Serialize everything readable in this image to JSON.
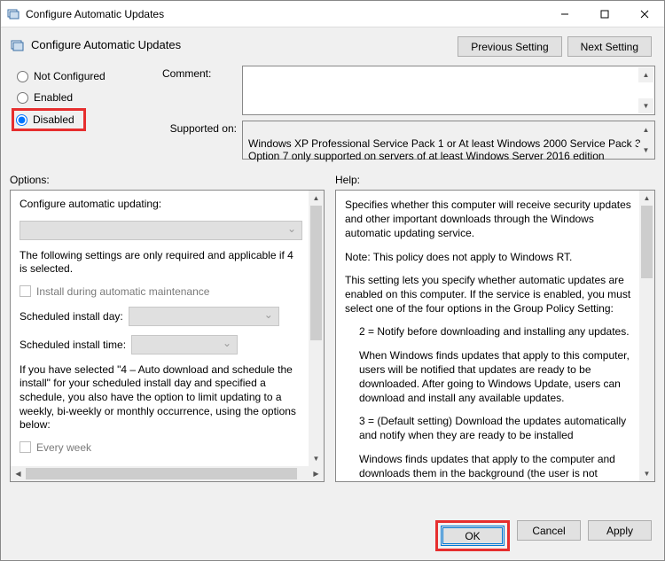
{
  "window": {
    "title": "Configure Automatic Updates"
  },
  "header": {
    "title": "Configure Automatic Updates",
    "prev_btn": "Previous Setting",
    "next_btn": "Next Setting"
  },
  "radios": {
    "not_configured": "Not Configured",
    "enabled": "Enabled",
    "disabled": "Disabled",
    "selected": "disabled"
  },
  "fields": {
    "comment_label": "Comment:",
    "comment_value": "",
    "supported_label": "Supported on:",
    "supported_value": "Windows XP Professional Service Pack 1 or At least Windows 2000 Service Pack 3\nOption 7 only supported on servers of at least Windows Server 2016 edition"
  },
  "labels": {
    "options": "Options:",
    "help": "Help:"
  },
  "options_pane": {
    "configure_label": "Configure automatic updating:",
    "note": "The following settings are only required and applicable if 4 is selected.",
    "install_maint": "Install during automatic maintenance",
    "day_label": "Scheduled install day:",
    "time_label": "Scheduled install time:",
    "para": "If you have selected \"4 – Auto download and schedule the install\" for your scheduled install day and specified a schedule, you also have the option to limit updating to a weekly, bi-weekly or monthly occurrence, using the options below:",
    "every_week": "Every week"
  },
  "help_pane": {
    "p1": "Specifies whether this computer will receive security updates and other important downloads through the Windows automatic updating service.",
    "p2": "Note: This policy does not apply to Windows RT.",
    "p3": "This setting lets you specify whether automatic updates are enabled on this computer. If the service is enabled, you must select one of the four options in the Group Policy Setting:",
    "p4": "2 = Notify before downloading and installing any updates.",
    "p5": "When Windows finds updates that apply to this computer, users will be notified that updates are ready to be downloaded. After going to Windows Update, users can download and install any available updates.",
    "p6": "3 = (Default setting) Download the updates automatically and notify when they are ready to be installed",
    "p7": "Windows finds updates that apply to the computer and downloads them in the background (the user is not notified or interrupted during"
  },
  "footer": {
    "ok": "OK",
    "cancel": "Cancel",
    "apply": "Apply"
  }
}
